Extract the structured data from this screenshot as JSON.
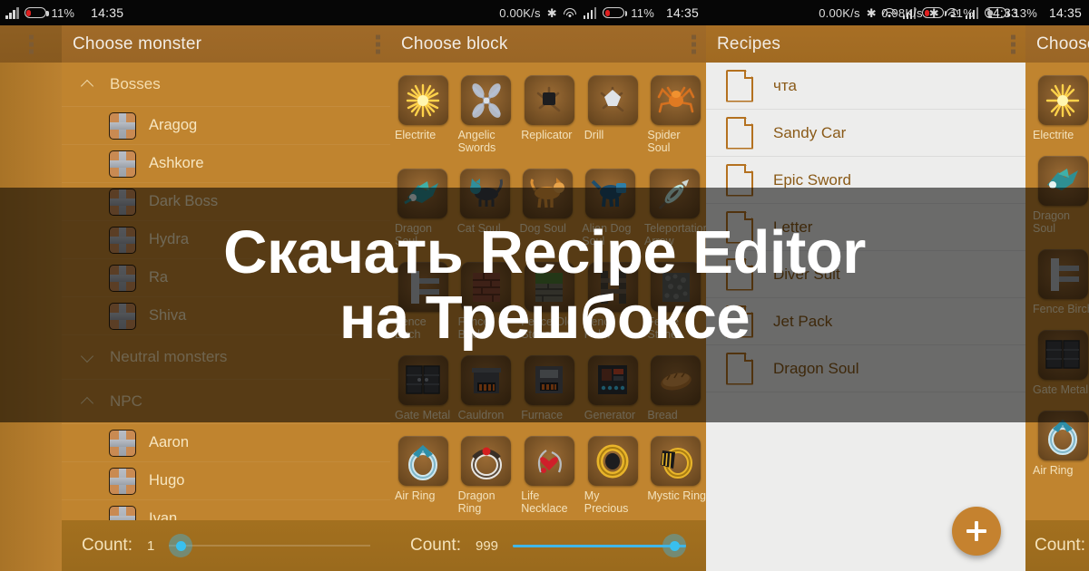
{
  "status_bars": [
    {
      "network": "",
      "bluetooth": "bluetooth-icon",
      "wifi": "wifi-icon",
      "signal": "signal-icon",
      "battery": "11%",
      "clock": "14:35"
    },
    {
      "network": "0.00K/s",
      "bluetooth": "bluetooth-icon",
      "wifi": "wifi-icon",
      "signal": "signal-icon",
      "battery": "11%",
      "clock": "14:35"
    },
    {
      "network": "0.00K/s",
      "bluetooth": "bluetooth-icon",
      "wifi": "wifi-icon",
      "signal": "signal-icon",
      "battery": "11%",
      "clock": "14:33"
    },
    {
      "network": "0.98K/s",
      "bluetooth": "bluetooth-icon",
      "wifi": "wifi-icon",
      "signal": "signal-icon",
      "battery": "13%",
      "clock": "14:35"
    }
  ],
  "overlay": {
    "line1": "Скачать Recipe Editor",
    "line2": "на Трешбоксе",
    "text_color": "#ffffff"
  },
  "theme": {
    "accent": "#c5822f",
    "appbar": "#9a6626",
    "list_bg": "#c0842f",
    "recipe_bg": "#ededec",
    "recipe_text": "#8a5a18",
    "slider": "#39c0ee",
    "label": "#f5deb0"
  },
  "panel_monster": {
    "title": "Choose monster",
    "menu": "overflow-menu-icon",
    "groups": [
      {
        "label": "Bosses",
        "expanded": true,
        "items": [
          "Aragog",
          "Ashkore",
          "Dark Boss",
          "Hydra",
          "Ra",
          "Shiva"
        ]
      },
      {
        "label": "Neutral monsters",
        "expanded": false,
        "items": []
      },
      {
        "label": "NPC",
        "expanded": true,
        "items": [
          "Aaron",
          "Hugo",
          "Ivan"
        ]
      }
    ],
    "count_label": "Count:",
    "count_value": "1",
    "slider_percent": 2
  },
  "panel_block": {
    "title": "Choose block",
    "menu": "overflow-menu-icon",
    "rows": [
      [
        {
          "name": "Electrite",
          "icon": "electrite-icon"
        },
        {
          "name": "Angelic Swords",
          "icon": "angelic-swords-icon"
        },
        {
          "name": "Replicator",
          "icon": "replicator-icon"
        },
        {
          "name": "Drill",
          "icon": "drill-icon"
        },
        {
          "name": "Spider Soul",
          "icon": "spider-soul-icon"
        }
      ],
      [
        {
          "name": "Dragon Soul",
          "icon": "dragon-soul-icon"
        },
        {
          "name": "Cat Soul",
          "icon": "cat-soul-icon"
        },
        {
          "name": "Dog Soul",
          "icon": "dog-soul-icon"
        },
        {
          "name": "Alien Dog Soul",
          "icon": "alien-dog-soul-icon"
        },
        {
          "name": "Teleportation Arrow",
          "icon": "teleportation-arrow-icon"
        }
      ],
      [
        {
          "name": "Fence Birch",
          "icon": "fence-birch-icon"
        },
        {
          "name": "Fence Brick",
          "icon": "fence-brick-icon"
        },
        {
          "name": "Fence Old Stone",
          "icon": "fence-old-stone-icon"
        },
        {
          "name": "Fence Palm",
          "icon": "fence-palm-icon"
        },
        {
          "name": "Fence Stone",
          "icon": "fence-stone-icon"
        }
      ],
      [
        {
          "name": "Gate Metal",
          "icon": "gate-metal-icon"
        },
        {
          "name": "Cauldron",
          "icon": "cauldron-icon"
        },
        {
          "name": "Furnace",
          "icon": "furnace-icon"
        },
        {
          "name": "Generator",
          "icon": "generator-icon"
        },
        {
          "name": "Bread",
          "icon": "bread-icon"
        }
      ],
      [
        {
          "name": "Air Ring",
          "icon": "air-ring-icon"
        },
        {
          "name": "Dragon Ring",
          "icon": "dragon-ring-icon"
        },
        {
          "name": "Life Necklace",
          "icon": "life-necklace-icon"
        },
        {
          "name": "My Precious",
          "icon": "my-precious-icon"
        },
        {
          "name": "Mystic Ring",
          "icon": "mystic-ring-icon"
        }
      ]
    ],
    "count_label": "Count:",
    "count_value": "999",
    "slider_percent": 100
  },
  "panel_recipes": {
    "title": "Recipes",
    "menu": "overflow-menu-icon",
    "items": [
      {
        "name": "чта",
        "icon": "recipe-page-icon"
      },
      {
        "name": "Sandy Car",
        "icon": "recipe-page-icon"
      },
      {
        "name": "Epic Sword",
        "icon": "recipe-page-icon"
      },
      {
        "name": "Letter",
        "icon": "recipe-page-icon"
      },
      {
        "name": "Diver Suit",
        "icon": "recipe-page-icon"
      },
      {
        "name": "Jet Pack",
        "icon": "recipe-page-icon"
      },
      {
        "name": "Dragon Soul",
        "icon": "recipe-page-icon"
      }
    ],
    "add_button": "add-recipe-fab",
    "add_label": "+"
  },
  "panel_right": {
    "title": "Choose block",
    "title_visible": "Choose",
    "items": [
      {
        "name": "Electrite",
        "icon": "electrite-icon"
      },
      {
        "name": "Dragon Soul",
        "icon": "dragon-soul-icon"
      },
      {
        "name": "Fence Birch",
        "icon": "fence-birch-icon"
      },
      {
        "name": "Gate Metal",
        "icon": "gate-metal-icon"
      },
      {
        "name": "Air Ring",
        "icon": "air-ring-icon"
      }
    ],
    "count_label": "Count:"
  }
}
